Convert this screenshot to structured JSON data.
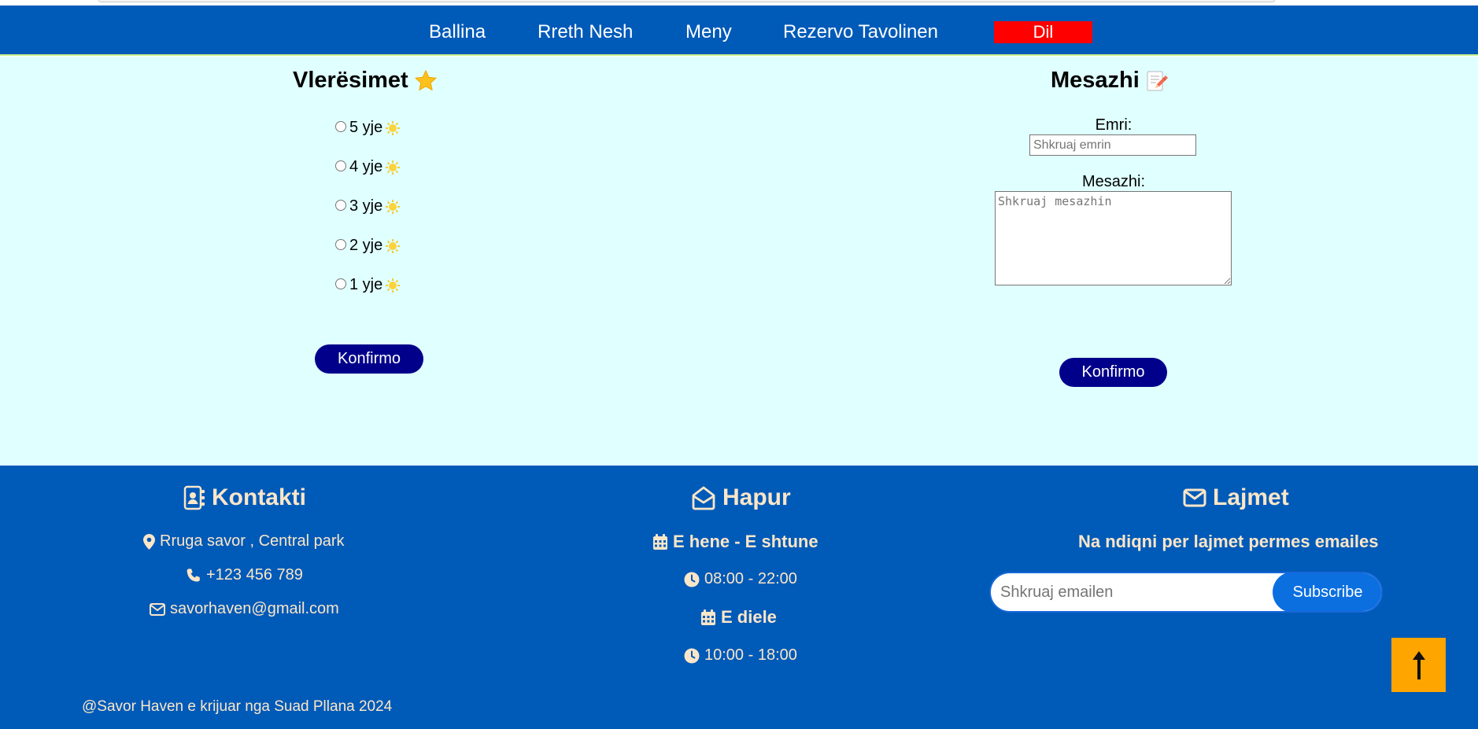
{
  "nav": {
    "home": "Ballina",
    "about": "Rreth Nesh",
    "menu": "Meny",
    "reserve": "Rezervo Tavolinen",
    "logout": "Dil"
  },
  "ratings": {
    "title": "Vlerësimet",
    "title_icon": "star-icon",
    "options": [
      {
        "label": "5 yje",
        "icon": "sun-icon"
      },
      {
        "label": "4 yje",
        "icon": "sun-icon"
      },
      {
        "label": "3 yje",
        "icon": "sun-icon"
      },
      {
        "label": "2 yje",
        "icon": "sun-icon"
      },
      {
        "label": "1 yje",
        "icon": "sun-icon"
      }
    ],
    "submit": "Konfirmo"
  },
  "message": {
    "title": "Mesazhi",
    "title_icon": "memo-icon",
    "name_label": "Emri:",
    "name_placeholder": "Shkruaj emrin",
    "message_label": "Mesazhi:",
    "message_placeholder": "Shkruaj mesazhin",
    "submit": "Konfirmo"
  },
  "footer": {
    "contact": {
      "title": "Kontakti",
      "address": "Rruga savor , Central park",
      "phone": "+123 456 789",
      "email": "savorhaven@gmail.com"
    },
    "hours": {
      "title": "Hapur",
      "weekdays_label": "E hene - E shtune",
      "weekdays_time": "08:00 - 22:00",
      "sunday_label": "E diele",
      "sunday_time": "10:00 - 18:00"
    },
    "news": {
      "title": "Lajmet",
      "tagline": "Na ndiqni per lajmet permes emailes",
      "placeholder": "Shkruaj emailen",
      "button": "Subscribe"
    },
    "copyright": "@Savor Haven e krijuar nga Suad Pllana 2024"
  },
  "colors": {
    "nav_bg": "#005ab8",
    "main_bg": "#e0ffff",
    "button_bg": "#00008b",
    "logout_bg": "#ff0000",
    "footer_text": "#fbe6c8",
    "back_to_top": "#ffa500"
  }
}
